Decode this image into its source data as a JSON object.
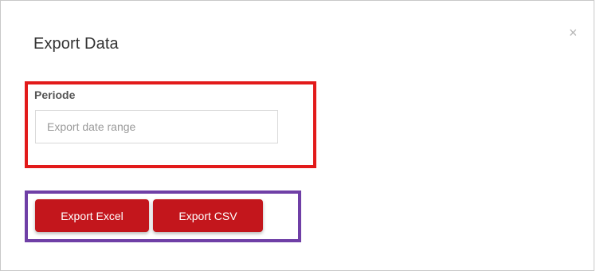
{
  "dialog": {
    "title": "Export Data",
    "close_label": "×"
  },
  "periode": {
    "label": "Periode",
    "placeholder": "Export date range",
    "value": ""
  },
  "actions": {
    "export_excel_label": "Export Excel",
    "export_csv_label": "Export CSV"
  },
  "colors": {
    "button_bg": "#c3161c",
    "highlight_red": "#e21a1a",
    "highlight_purple": "#6f3fa6"
  },
  "icons": {
    "close": "close-icon"
  }
}
